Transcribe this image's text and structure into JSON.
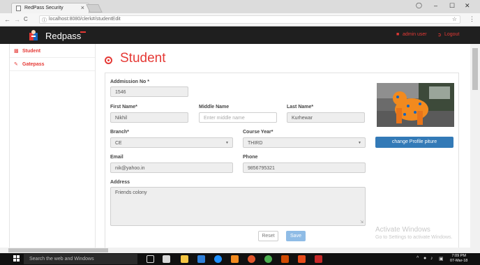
{
  "browser": {
    "tab_title": "RedPass Security",
    "tab_close": "×",
    "url": "localhost:8080/clerk#/studentEdit",
    "minimize": "–",
    "maximize": "☐",
    "close": "✕"
  },
  "navbar": {
    "brand": "Redpass",
    "user_link": "admin user",
    "logout_link": "Logout"
  },
  "sidebar": {
    "items": [
      {
        "label": "Student",
        "icon": "users-icon"
      },
      {
        "label": "Gatepass",
        "icon": "edit-icon"
      }
    ]
  },
  "page": {
    "title": "Student"
  },
  "form": {
    "admission_no_label": "Addmission No *",
    "admission_no_value": "1546",
    "first_name_label": "First Name*",
    "first_name_value": "Nikhil",
    "middle_name_label": "Middle Name",
    "middle_name_placeholder": "Enter middle name",
    "last_name_label": "Last Name*",
    "last_name_value": "Kurhewar",
    "branch_label": "Branch*",
    "branch_value": "CE",
    "course_year_label": "Course Year*",
    "course_year_value": "THIRD",
    "email_label": "Email",
    "email_value": "nik@yahoo.in",
    "phone_label": "Phone",
    "phone_value": "9856795321",
    "address_label": "Address",
    "address_value": "Friends colony",
    "reset_label": "Reset",
    "save_label": "Save",
    "change_photo_label": "change Profile piture"
  },
  "watermark": {
    "line1": "Activate Windows",
    "line2": "Go to Settings to activate Windows."
  },
  "taskbar": {
    "search_placeholder": "Search the web and Windows",
    "time": "7:09 PM",
    "date": "07-Mar-18"
  },
  "colors": {
    "accent": "#e53935",
    "primary_button": "#337ab7",
    "navbar": "#1f1f1f"
  }
}
